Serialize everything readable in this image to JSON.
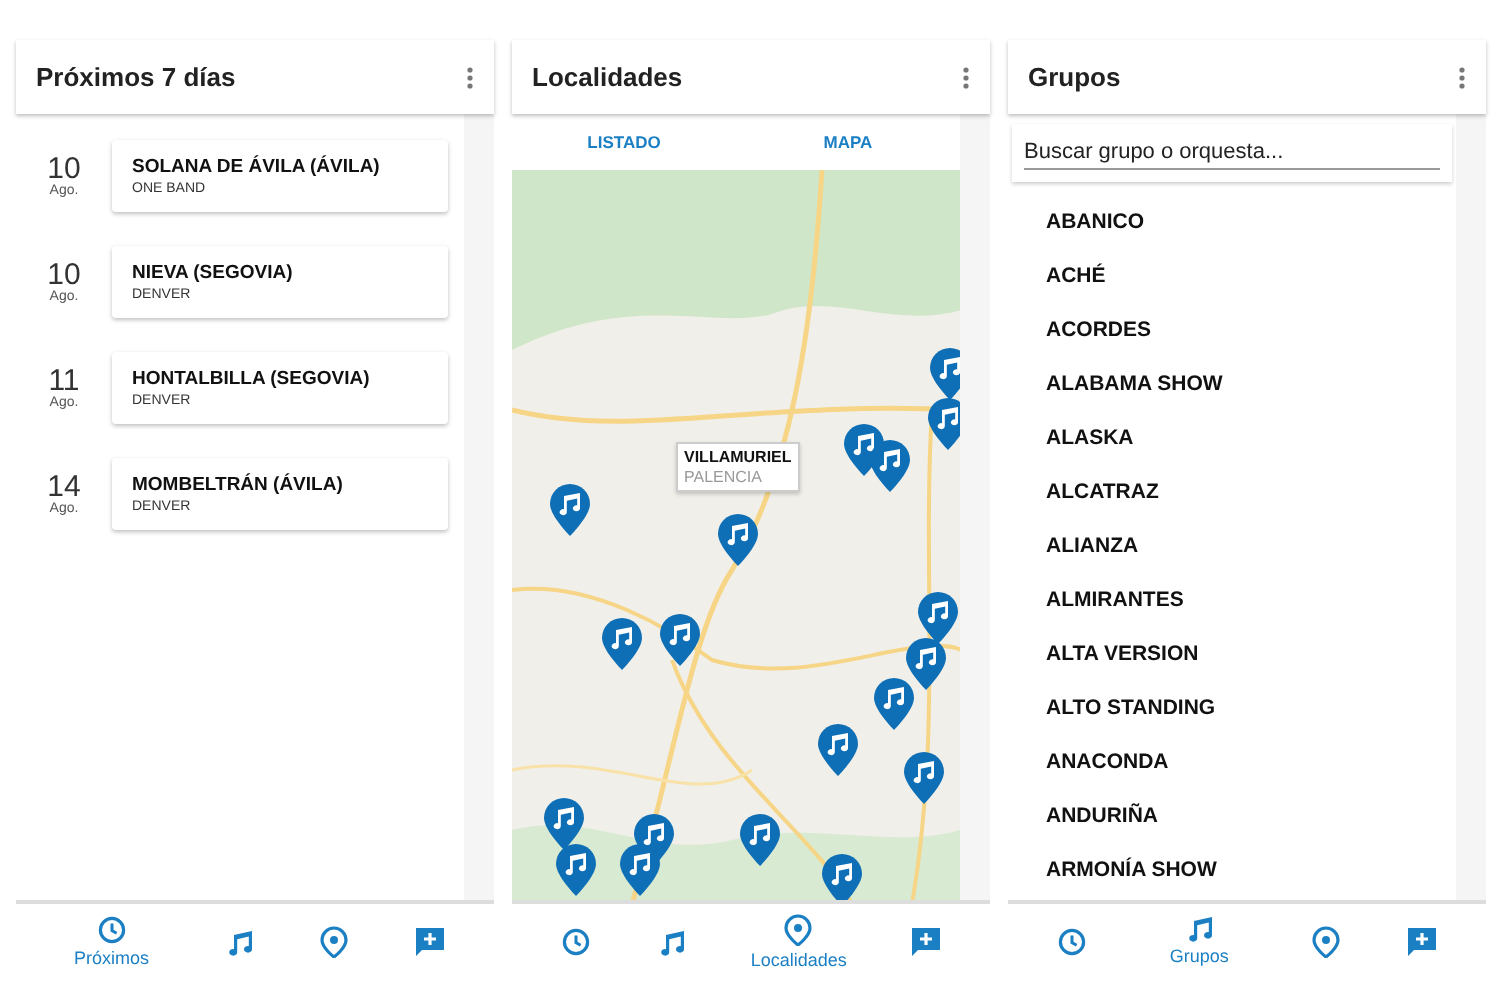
{
  "screens": [
    {
      "kind": "events",
      "title": "Próximos 7 días",
      "events": [
        {
          "day": "10",
          "month": "Ago.",
          "place": "SOLANA DE ÁVILA (ÁVILA)",
          "band": "ONE BAND"
        },
        {
          "day": "10",
          "month": "Ago.",
          "place": "NIEVA (SEGOVIA)",
          "band": "DENVER"
        },
        {
          "day": "11",
          "month": "Ago.",
          "place": "HONTALBILLA (SEGOVIA)",
          "band": "DENVER"
        },
        {
          "day": "14",
          "month": "Ago.",
          "place": "MOMBELTRÁN (ÁVILA)",
          "band": "DENVER"
        }
      ],
      "nav": [
        {
          "kind": "clock",
          "selected": true,
          "label": "Próximos"
        },
        {
          "kind": "music",
          "selected": false
        },
        {
          "kind": "place",
          "selected": false
        },
        {
          "kind": "add",
          "selected": false
        }
      ]
    },
    {
      "kind": "map",
      "title": "Localidades",
      "tabs": [
        {
          "label": "LISTADO"
        },
        {
          "label": "MAPA"
        }
      ],
      "callout": {
        "title": "VILLAMURIEL",
        "subtitle": "PALENCIA"
      },
      "nav": [
        {
          "kind": "clock",
          "selected": false
        },
        {
          "kind": "music",
          "selected": false
        },
        {
          "kind": "place",
          "selected": true,
          "label": "Localidades"
        },
        {
          "kind": "add",
          "selected": false
        }
      ]
    },
    {
      "kind": "groups",
      "title": "Grupos",
      "search": {
        "placeholder": "Buscar grupo o orquesta..."
      },
      "groups": [
        "ABANICO",
        "ACHÉ",
        "ACORDES",
        "ALABAMA SHOW",
        "ALASKA",
        "ALCATRAZ",
        "ALIANZA",
        "ALMIRANTES",
        "ALTA VERSION",
        "ALTO STANDING",
        "ANACONDA",
        "ANDURIÑA",
        "ARMONÍA SHOW"
      ],
      "nav": [
        {
          "kind": "clock",
          "selected": false
        },
        {
          "kind": "music",
          "selected": true,
          "label": "Grupos"
        },
        {
          "kind": "place",
          "selected": false
        },
        {
          "kind": "add",
          "selected": false
        }
      ]
    }
  ]
}
